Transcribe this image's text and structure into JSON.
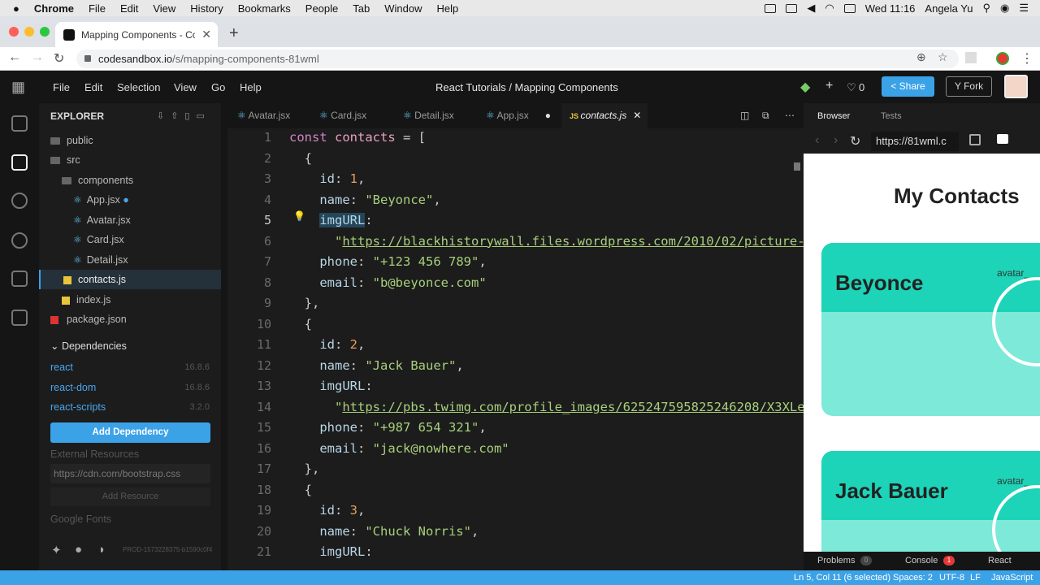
{
  "menubar": {
    "app": "Chrome",
    "items": [
      "File",
      "Edit",
      "View",
      "History",
      "Bookmarks",
      "People",
      "Tab",
      "Window",
      "Help"
    ],
    "clock": "Wed 11:16",
    "user": "Angela Yu"
  },
  "browser": {
    "tab_title": "Mapping Components - CodeSandbox",
    "url_host": "codesandbox.io",
    "url_path": "/s/mapping-components-81wml"
  },
  "csb": {
    "menu": [
      "File",
      "Edit",
      "Selection",
      "View",
      "Go",
      "Help"
    ],
    "breadcrumb": "React Tutorials / Mapping Components",
    "likes": "0",
    "share": "Share",
    "fork": "Fork"
  },
  "explorer": {
    "title": "EXPLORER",
    "files": [
      {
        "label": "public",
        "type": "folder"
      },
      {
        "label": "src",
        "type": "folder"
      },
      {
        "label": "components",
        "type": "folder"
      },
      {
        "label": "App.jsx",
        "type": "react"
      },
      {
        "label": "Avatar.jsx",
        "type": "react"
      },
      {
        "label": "Card.jsx",
        "type": "react"
      },
      {
        "label": "Detail.jsx",
        "type": "react"
      },
      {
        "label": "contacts.js",
        "type": "js"
      },
      {
        "label": "index.js",
        "type": "js"
      },
      {
        "label": "package.json",
        "type": "pkg"
      }
    ],
    "deps_title": "Dependencies",
    "deps": [
      {
        "name": "react",
        "version": "16.8.6"
      },
      {
        "name": "react-dom",
        "version": "16.8.6"
      },
      {
        "name": "react-scripts",
        "version": "3.2.0"
      }
    ],
    "add_dependency": "Add Dependency",
    "external_title": "External Resources",
    "external_placeholder": "https://cdn.com/bootstrap.css",
    "add_resource": "Add Resource",
    "google_fonts": "Google Fonts",
    "build": "PROD-1573228375-b1590c0f4"
  },
  "tabs": [
    "Avatar.jsx",
    "Card.jsx",
    "Detail.jsx",
    "App.jsx",
    "contacts.js"
  ],
  "code": {
    "lines": [
      [
        "1",
        "const contacts = ["
      ],
      [
        "2",
        "  {"
      ],
      [
        "3",
        "    id: 1,"
      ],
      [
        "4",
        "    name: \"Beyonce\","
      ],
      [
        "5",
        "    imgURL:"
      ],
      [
        "6",
        "      \"https://blackhistorywall.files.wordpress.com/2010/02/picture-"
      ],
      [
        "7",
        "    phone: \"+123 456 789\","
      ],
      [
        "8",
        "    email: \"b@beyonce.com\""
      ],
      [
        "9",
        "  },"
      ],
      [
        "10",
        "  {"
      ],
      [
        "11",
        "    id: 2,"
      ],
      [
        "12",
        "    name: \"Jack Bauer\","
      ],
      [
        "13",
        "    imgURL:"
      ],
      [
        "14",
        "      \"https://pbs.twimg.com/profile_images/625247595825246208/X3XLe"
      ],
      [
        "15",
        "    phone: \"+987 654 321\","
      ],
      [
        "16",
        "    email: \"jack@nowhere.com\""
      ],
      [
        "17",
        "  },"
      ],
      [
        "18",
        "  {"
      ],
      [
        "19",
        "    id: 3,"
      ],
      [
        "20",
        "    name: \"Chuck Norris\","
      ],
      [
        "21",
        "    imgURL:"
      ]
    ]
  },
  "preview": {
    "tab_browser": "Browser",
    "tab_tests": "Tests",
    "url": "https://81wml.c",
    "heading": "My Contacts",
    "cards": [
      {
        "name": "Beyonce",
        "alt": "avatar_"
      },
      {
        "name": "Jack Bauer",
        "alt": "avatar_"
      }
    ],
    "problems": "Problems",
    "problems_count": "0",
    "console": "Console",
    "console_count": "1",
    "react": "React"
  },
  "status": {
    "position": "Ln 5, Col 11 (6 selected)",
    "spaces": "Spaces: 2",
    "encoding": "UTF-8",
    "eol": "LF",
    "lang": "JavaScript"
  },
  "colors": {
    "accent": "#3ca2e7",
    "card_top": "#1dd4b8",
    "card_body": "#7de9d8"
  }
}
